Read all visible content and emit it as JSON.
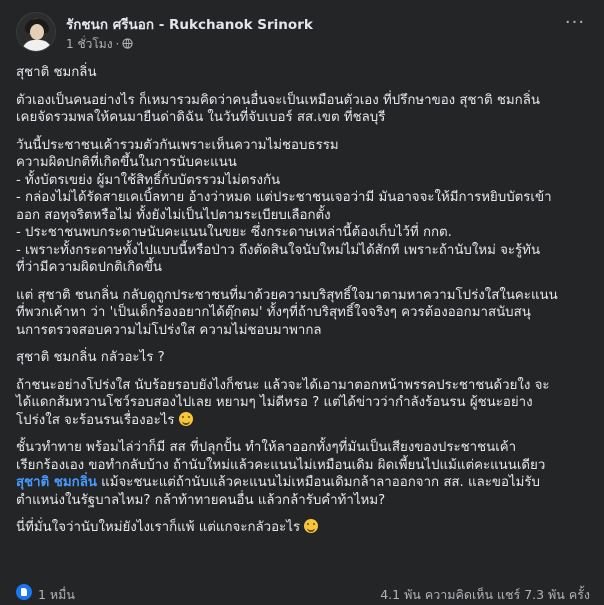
{
  "post": {
    "author": "รักชนก ศรีนอก - Rukchanok Srinork",
    "time": "1 ชั่วโมง",
    "separator": "·",
    "more_icon": "more-horizontal-icon",
    "privacy_icon": "globe-icon"
  },
  "content": {
    "p1": "สุชาติ ชมกลิ่น",
    "p2": [
      "ตัวเองเป็นคนอย่างไร ก็เหมารวมคิดว่าคนอื่นจะเป็นเหมือนตัวเอง ที่ปรึกษาของ สุชาติ ชมกลิ่น",
      "เคยจัดรวมพลให้คนมายืนด่าดิฉัน ในวันที่จับเบอร์ สส.เขต ที่ชลบุรี"
    ],
    "p3": [
      "วันนี้ประชาชนเค้ารวมตัวกันเพราะเห็นความไม่ชอบธรรม",
      "ความผิดปกติที่เกิดขึ้นในการนับคะแนน",
      "- ทั้งบัตรเขย่ง ผู้มาใช้สิทธิ์กับบัตรรวมไม่ตรงกัน",
      "- กล่องไม่ได้รัดสายเคเบิ้ลทาย อ้างว่าหมด แต่ประชาชนเจอว่ามี มันอาจจะให้มีการหยิบบัตรเข้า",
      "ออก สอทุจริตหรือไม่ ทั้งยังไม่เป็นไปตามระเบียบเลือกตั้ง",
      "- ประชาชนพบกระดาษนับคะแนนในขยะ ซึ่งกระดาษเหล่านี้ต้องเก็บไว้ที่ กกต.",
      "- เพราะทั้งกระดาษทั้งไปแบบนี้หรือป่าว ถึงตัดสินใจนับใหม่ไม่ได้สักที เพราะถ้านับใหม่ จะรู้ทัน",
      "ที่ว่ามีความผิดปกติเกิดขึ้น"
    ],
    "p4": [
      "แต่ สุชาติ ชนกลิ่น กลับดูถูกประชาชนที่มาด้วยความบริสุทธิ์ใจมาตามหาความโปร่งใสในคะแนน",
      "ที่พวกเค้าหา ว่า 'เป็นเด็กร้องอยากได้ตุ๊กตม' ทั้งๆที่ถ้าบริสุทธิ์ใจจริงๆ ควรต้องออกมาสนับสนุ",
      "นการตรวจสอบความไม่โปร่งใส ความไม่ชอบมาพากล"
    ],
    "p5": "สุชาติ ชมกลิ่น กลัวอะไร ?",
    "p6": [
      "ถ้าชนะอย่างโปร่งใส นับร้อยรอบยังไงก็ชนะ แล้วจะได้เอามาตอกหน้าพรรคประชาชนด้วยใง จะ",
      "ได้แดกส้มหวานโชว์รอบสองไปเลย หยามๆ ไม่ดีหรอ ? แต่ได้ข่าวว่ากำลังร้อนรน ผู้ชนะอย่าง",
      "โปร่งใส จะร้อนรนเรื่องอะไร"
    ],
    "p7_before": [
      "ชั้นวทำทาย พร้อมไล่ว่าก็มี สส ที่ปลุกปั้น ทำให้ลาออกทั้งๆที่มันเป็นเสียงของประชาชนเค้า",
      "เรียกร้องเอง ขอทำกลับบ้าง ถ้านับใหม่แล้วคะแนนไม่เหมือนเดิม ผิดเพี้ยนไปแม้แต่คะแนนเดียว"
    ],
    "p7_mention": "สุชาติ ชมกลิ่น",
    "p7_after_mention": " แม้จะชนะแต่ถ้านับแล้วคะแนนไม่เหมือนเดิมกล้าลาออกจาก สส. และขอไม่รับ",
    "p7_last": "ตำแหน่งในรัฐบาลไหม? กล้าท้าทายคนอื่น แล้วกล้ารับคำท้าไหม?",
    "p8": "นี่ที่มั่นใจว่านับใหม่ยังไงเราก็แพ้ แต่แกจะกลัวอะไร"
  },
  "footer": {
    "reaction_icon": "like-reaction-icon",
    "reactions": "1 หมื่น",
    "stats": "4.1 พัน ความคิดเห็น  แชร์ 7.3 พัน ครั้ง"
  },
  "colors": {
    "background": "#242526",
    "text": "#e4e6eb",
    "secondary_text": "#b0b3b8",
    "mention": "#4599ff"
  }
}
